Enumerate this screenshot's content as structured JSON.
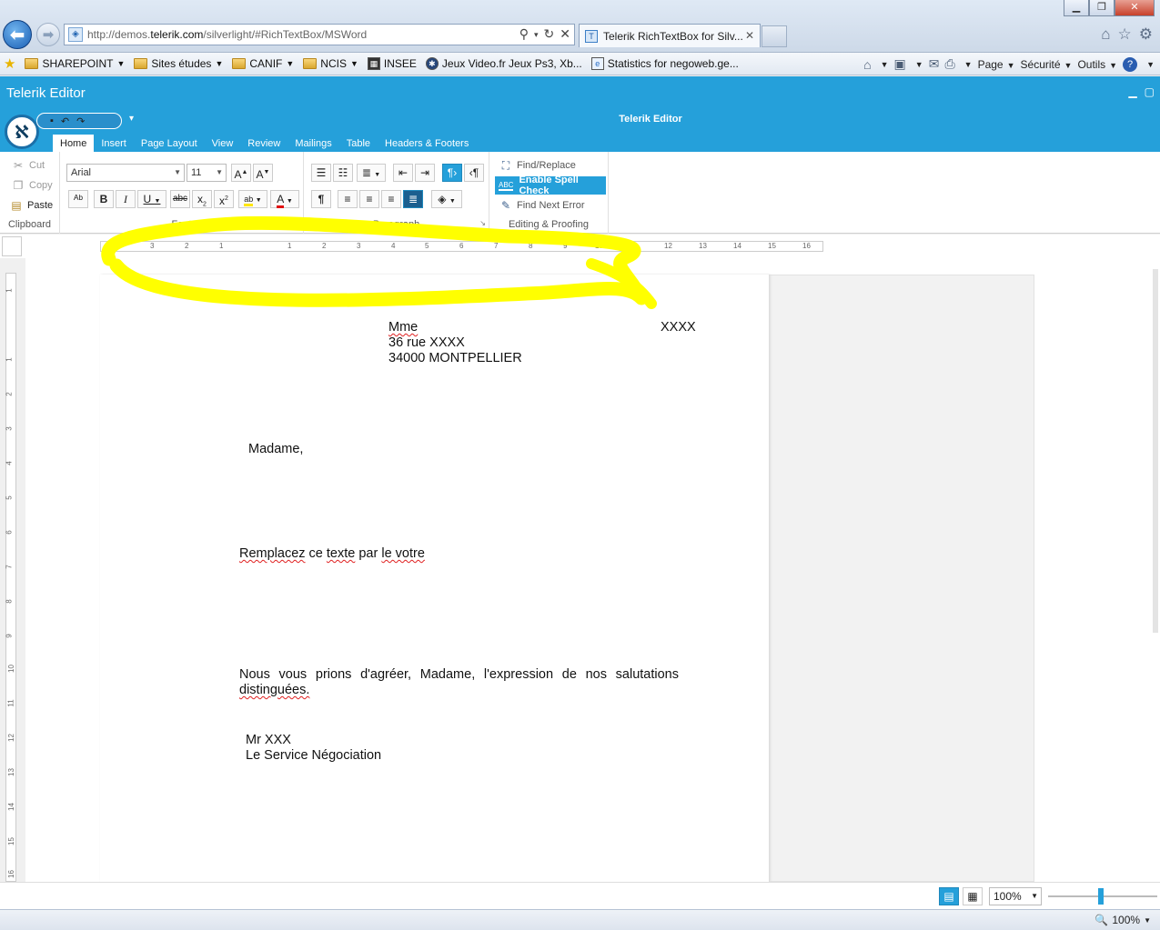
{
  "browser": {
    "url_prefix": "http://demos.",
    "url_domain": "telerik.com",
    "url_path": "/silverlight/#RichTextBox/MSWord",
    "tab_title": "Telerik RichTextBox for Silv...",
    "favorites": [
      {
        "label": "SHAREPOINT",
        "type": "folder"
      },
      {
        "label": "Sites études",
        "type": "folder"
      },
      {
        "label": "CANIF",
        "type": "folder"
      },
      {
        "label": "NCIS",
        "type": "folder"
      },
      {
        "label": "INSEE",
        "type": "site"
      },
      {
        "label": "Jeux Video.fr  Jeux Ps3, Xb...",
        "type": "site"
      },
      {
        "label": "Statistics for negoweb.ge...",
        "type": "site"
      }
    ],
    "commands": {
      "page": "Page",
      "security": "Sécurité",
      "tools": "Outils"
    },
    "zoom": "100%"
  },
  "app": {
    "title": "Telerik Editor",
    "doc_title": "Telerik Editor",
    "tabs": [
      "Home",
      "Insert",
      "Page Layout",
      "View",
      "Review",
      "Mailings",
      "Table",
      "Headers & Footers"
    ],
    "active_tab": "Home"
  },
  "ribbon": {
    "clipboard": {
      "label": "Clipboard",
      "cut": "Cut",
      "copy": "Copy",
      "paste": "Paste"
    },
    "font": {
      "label": "Font",
      "family": "Arial",
      "size": "11"
    },
    "paragraph": {
      "label": "Paragraph"
    },
    "editing": {
      "label": "Editing & Proofing",
      "find_replace": "Find/Replace",
      "spell_check": "Enable Spell Check",
      "find_next_error": "Find Next Error"
    }
  },
  "ruler": {
    "h_ticks": [
      "4",
      "3",
      "2",
      "1",
      "1",
      "2",
      "3",
      "4",
      "5",
      "6",
      "7",
      "8",
      "9",
      "10",
      "11",
      "12",
      "13",
      "14",
      "15",
      "16"
    ],
    "v_ticks": [
      "1",
      "1",
      "2",
      "3",
      "4",
      "5",
      "6",
      "7",
      "8",
      "9",
      "10",
      "11",
      "12",
      "13",
      "14",
      "15",
      "16"
    ]
  },
  "document": {
    "addr_name": "Mme",
    "addr_right": "XXXX",
    "addr_street": "36 rue XXXX",
    "addr_city": "34000 MONTPELLIER",
    "salutation": "Madame,",
    "body_word1": "Remplacez",
    "body_word2": " ce ",
    "body_word3": "texte",
    "body_word4": " par ",
    "body_word5": "le votre",
    "closing_line1": "Nous vous prions d'agréer, Madame, l'expression de nos salutations",
    "closing_line2": "distinguées.",
    "sign_name": "Mr XXX",
    "sign_service": "Le Service Négociation"
  },
  "status": {
    "zoom": "100%"
  },
  "colors": {
    "accent": "#25a0da",
    "highlighter": "#ffff00",
    "spell_error": "#e02020"
  }
}
